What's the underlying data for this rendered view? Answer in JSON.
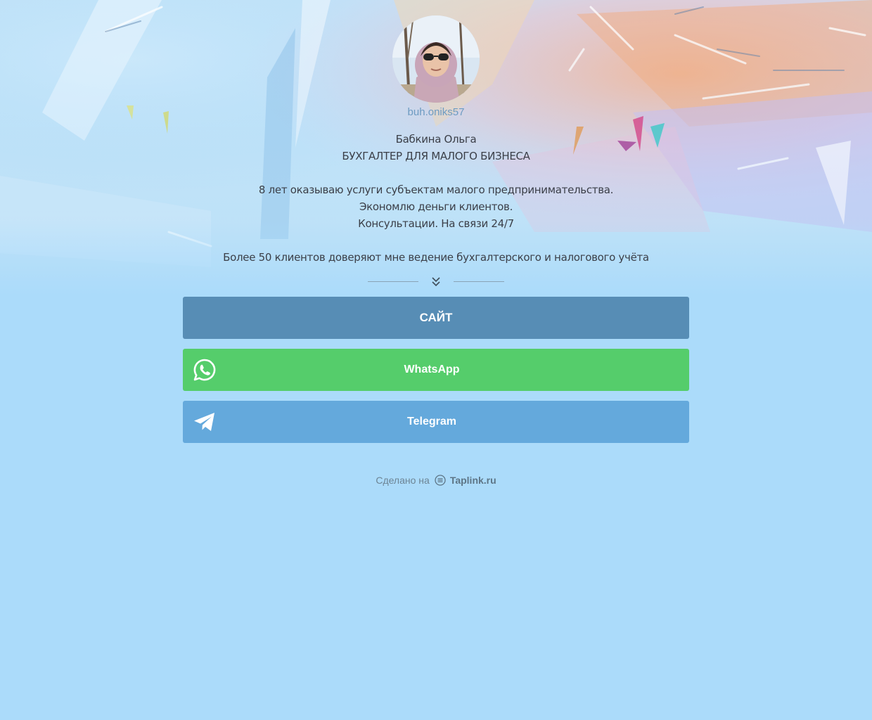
{
  "profile": {
    "username": "buh.oniks57",
    "name": "Бабкина Ольга",
    "tagline": "БУХГАЛТЕР ДЛЯ МАЛОГО БИЗНЕСА",
    "bio_lines": [
      "8 лет оказываю услуги субъектам малого предпринимательства.",
      "Экономлю деньги клиентов.",
      "Консультации. На связи 24/7"
    ],
    "clients_line": "Более 50 клиентов доверяют мне ведение бухгалтерского и налогового учёта"
  },
  "buttons": [
    {
      "label": "САЙТ",
      "color": "#578db5"
    },
    {
      "label": "WhatsApp",
      "icon": "whatsapp-icon",
      "color": "#55cd6b"
    },
    {
      "label": "Telegram",
      "icon": "telegram-icon",
      "color": "#64a9dc"
    }
  ],
  "footer": {
    "prefix": "Сделано на",
    "brand": "Taplink.ru",
    "icon": "taplink-logo-icon"
  },
  "colors": {
    "page_background": "#abdbfa",
    "username": "#6d9bc2",
    "text": "#3b3f48"
  }
}
